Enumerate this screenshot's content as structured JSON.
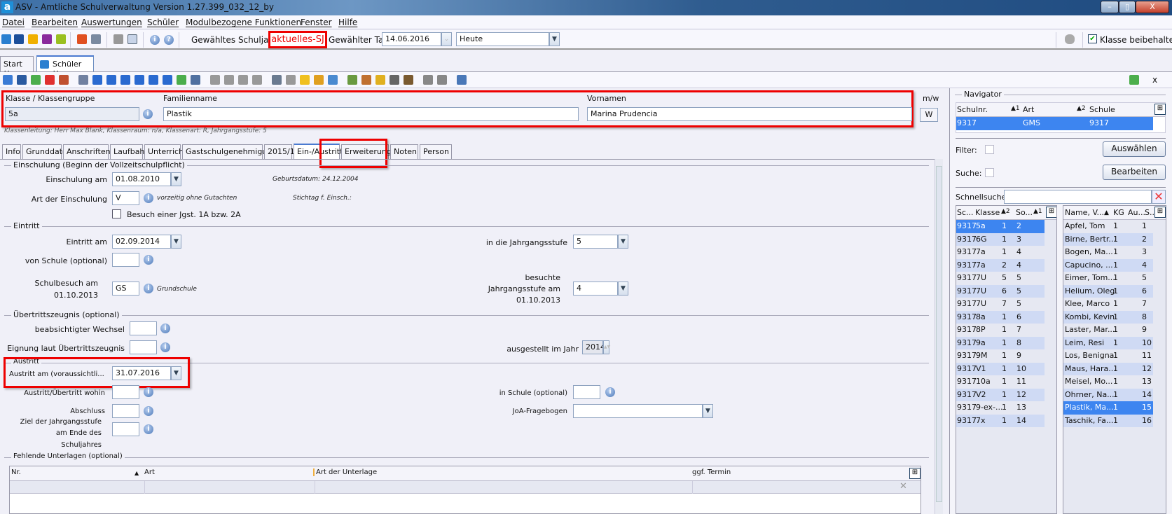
{
  "window": {
    "title": "ASV - Amtliche Schulverwaltung Version 1.27.399_032_12_by",
    "logo": "a",
    "min": "–",
    "max": "▯",
    "close": "X"
  },
  "menu": [
    "Datei",
    "Bearbeiten",
    "Auswertungen",
    "Schüler",
    "Modulbezogene Funktionen",
    "Fenster",
    "Hilfe"
  ],
  "toolbar": {
    "schuljahr_label": "Gewähltes Schuljahr",
    "schuljahr_value": "aktuelles-SJ",
    "tag_label": "Gewählter Tag",
    "tag_value": "14.06.2016",
    "tag_mode": "Heute",
    "klasse_beibehalten": "Klasse beibehalten",
    "klasse_beibehalten_checked": true
  },
  "doc_tabs": [
    {
      "label": "Start",
      "close": "✕"
    },
    {
      "label": "Schüler",
      "close": "✕"
    }
  ],
  "panel_close": "x",
  "header": {
    "klasse_label": "Klasse / Klassengruppe",
    "klasse_value": "5a",
    "familienname_label": "Familienname",
    "familienname_value": "Plastik",
    "vornamen_label": "Vornamen",
    "vornamen_value": "Marina Prudencia",
    "mw_label": "m/w",
    "mw_value": "W",
    "info_line": "Klassenleitung: Herr Max Blank, Klassenraum: n/a, Klassenart: R, Jahrgangsstufe: 5"
  },
  "tabs": [
    "Info",
    "Grunddaten",
    "Anschriften",
    "Laufbahn",
    "Unterricht",
    "Gastschulgenehmigung",
    "2015/16",
    "Ein-/Austritt",
    "Erweiterungen",
    "Noten",
    "Person"
  ],
  "active_tab": "Ein-/Austritt",
  "form": {
    "einschulung": {
      "title": "Einschulung (Beginn der Vollzeitschulpflicht)",
      "am_label": "Einschulung am",
      "am_value": "01.08.2010",
      "geburtsdatum": "Geburtsdatum: 24.12.2004",
      "art_label": "Art der Einschulung",
      "art_value": "V",
      "art_text": "vorzeitig ohne Gutachten",
      "stichtag": "Stichtag f. Einsch.:",
      "besuch_label": "Besuch einer Jgst. 1A bzw. 2A",
      "besuch_checked": false
    },
    "eintritt": {
      "title": "Eintritt",
      "am_label": "Eintritt am",
      "am_value": "02.09.2014",
      "jgst_label": "in die Jahrgangsstufe",
      "jgst_value": "5",
      "von_schule_label": "von Schule (optional)",
      "von_schule_value": "",
      "schulbesuch_label1": "Schulbesuch am",
      "schulbesuch_label2": "01.10.2013",
      "schulbesuch_value": "GS",
      "schulbesuch_text": "Grundschule",
      "besuchte_label1": "besuchte",
      "besuchte_label2": "Jahrgangsstufe am",
      "besuchte_label3": "01.10.2013",
      "besuchte_value": "4"
    },
    "uebertritt": {
      "title": "Übertrittszeugnis (optional)",
      "wechsel_label": "beabsichtigter Wechsel",
      "eignung_label": "Eignung laut Übertrittszeugnis",
      "ausgestellt_label": "ausgestellt im Jahr",
      "ausgestellt_value": "2014"
    },
    "austritt": {
      "title": "Austritt",
      "am_label": "Austritt am (voraussichtli...",
      "am_value": "31.07.2016",
      "wohin_label": "Austritt/Übertritt wohin",
      "in_schule_label": "in Schule (optional)",
      "abschluss_label": "Abschluss",
      "joa_label": "JoA-Fragebogen",
      "joa_value": "",
      "ziel_label1": "Ziel der Jahrgangsstufe",
      "ziel_label2": "am Ende des",
      "ziel_label3": "Schuljahres"
    },
    "unterlagen": {
      "title": "Fehlende Unterlagen (optional)",
      "columns": [
        "Nr.",
        "Art",
        "Art der Unterlage",
        "ggf. Termin"
      ]
    }
  },
  "navigator": {
    "title": "Navigator",
    "columns": [
      "Schulnr.",
      "Art",
      "Schule"
    ],
    "sort": [
      "▲1",
      "▲2"
    ],
    "row": [
      "9317",
      "GMS",
      "9317"
    ],
    "filter_label": "Filter:",
    "suche_label": "Suche:",
    "auswaehlen": "Auswählen",
    "bearbeiten": "Bearbeiten",
    "schnellsuche_label": "Schnellsuche",
    "schnellsuche_value": "",
    "klassen_columns": [
      "Sc...",
      "Klasse",
      "▲2",
      "So...",
      "▲1"
    ],
    "klassen": [
      [
        "9317",
        "5a",
        "1",
        "2"
      ],
      [
        "9317",
        "6G",
        "1",
        "3"
      ],
      [
        "9317",
        "7a",
        "1",
        "4"
      ],
      [
        "9317",
        "7a",
        "2",
        "4"
      ],
      [
        "9317",
        "7U",
        "5",
        "5"
      ],
      [
        "9317",
        "7U",
        "6",
        "5"
      ],
      [
        "9317",
        "7U",
        "7",
        "5"
      ],
      [
        "9317",
        "8a",
        "1",
        "6"
      ],
      [
        "9317",
        "8P",
        "1",
        "7"
      ],
      [
        "9317",
        "9a",
        "1",
        "8"
      ],
      [
        "9317",
        "9M",
        "1",
        "9"
      ],
      [
        "9317",
        "V1",
        "1",
        "10"
      ],
      [
        "9317",
        "10a",
        "1",
        "11"
      ],
      [
        "9317",
        "V2",
        "1",
        "12"
      ],
      [
        "9317",
        "9-ex-...",
        "1",
        "13"
      ],
      [
        "9317",
        "7x",
        "1",
        "14"
      ]
    ],
    "schueler_columns": [
      "Name, V...",
      "▲",
      "KG",
      "Au...",
      "S..."
    ],
    "schueler": [
      [
        "Apfel, Tom",
        "1",
        "",
        "1"
      ],
      [
        "Birne, Bertr...",
        "1",
        "",
        "2"
      ],
      [
        "Bogen, Ma...",
        "1",
        "",
        "3"
      ],
      [
        "Capucino, ...",
        "1",
        "",
        "4"
      ],
      [
        "Eimer, Tom...",
        "1",
        "",
        "5"
      ],
      [
        "Helium, Oleg",
        "1",
        "",
        "6"
      ],
      [
        "Klee, Marco",
        "1",
        "",
        "7"
      ],
      [
        "Kombi, Kevin",
        "1",
        "",
        "8"
      ],
      [
        "Laster, Mar...",
        "1",
        "",
        "9"
      ],
      [
        "Leim, Resi",
        "1",
        "",
        "10"
      ],
      [
        "Los, Benigna",
        "1",
        "",
        "11"
      ],
      [
        "Maus, Hara...",
        "1",
        "",
        "12"
      ],
      [
        "Meisel, Mo...",
        "1",
        "",
        "13"
      ],
      [
        "Ohrner, Na...",
        "1",
        "",
        "14"
      ],
      [
        "Plastik, Ma...",
        "1",
        "",
        "15"
      ],
      [
        "Taschik, Fa...",
        "1",
        "",
        "16"
      ]
    ],
    "selected_klasse": 0,
    "selected_schueler": 14
  },
  "colors": {
    "highlight": "#e00000",
    "selection": "#3d85f0",
    "row_alt": "#cfdaf4"
  }
}
